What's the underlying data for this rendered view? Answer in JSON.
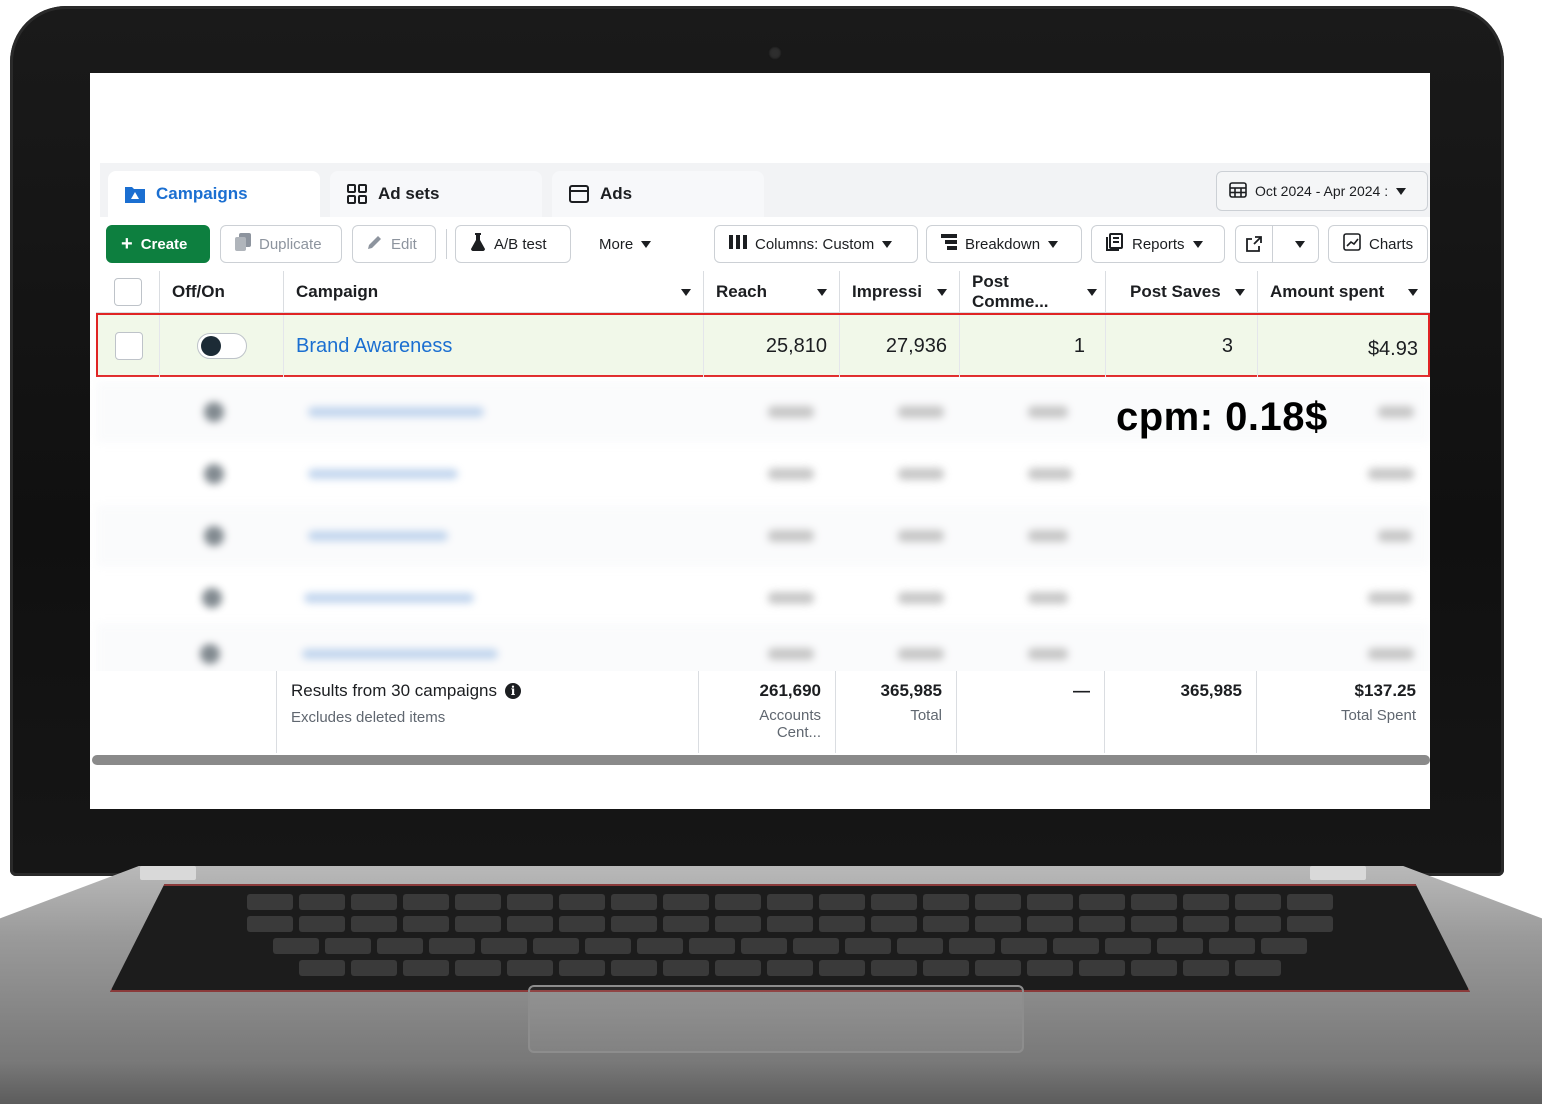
{
  "tabs": [
    {
      "label": "Campaigns",
      "icon": "campaign-folder-icon",
      "active": true
    },
    {
      "label": "Ad sets",
      "icon": "grid-icon",
      "active": false
    },
    {
      "label": "Ads",
      "icon": "ad-window-icon",
      "active": false
    }
  ],
  "date_range": {
    "label": "Oct 2024 - Apr 2024 :"
  },
  "toolbar": {
    "create_label": "Create",
    "duplicate_label": "Duplicate",
    "edit_label": "Edit",
    "ab_test_label": "A/B test",
    "more_label": "More",
    "columns_label": "Columns: Custom",
    "breakdown_label": "Breakdown",
    "reports_label": "Reports",
    "charts_label": "Charts"
  },
  "table": {
    "headers": {
      "off_on": "Off/On",
      "campaign": "Campaign",
      "reach": "Reach",
      "impressions": "Impressi",
      "post_comments": "Post Comme...",
      "post_saves": "Post Saves",
      "amount_spent": "Amount spent"
    },
    "highlighted_row": {
      "campaign": "Brand Awareness",
      "reach": "25,810",
      "impressions": "27,936",
      "post_comments": "1",
      "post_saves": "3",
      "amount_spent": "$4.93"
    }
  },
  "annotation": {
    "cpm": "cpm:  0.18$"
  },
  "summary": {
    "title": "Results from 30 campaigns",
    "subtitle": "Excludes deleted items",
    "reach_value": "261,690",
    "reach_note": "Accounts Cent...",
    "impressions_value": "365,985",
    "impressions_note": "Total",
    "post_comments_value": "—",
    "post_saves_value": "365,985",
    "amount_spent_value": "$137.25",
    "amount_spent_note": "Total Spent"
  },
  "colors": {
    "accent_blue": "#1b6fd1",
    "create_green": "#0d7f3f",
    "highlight_red": "#e02424",
    "highlight_row_bg": "#f1f8e9"
  }
}
